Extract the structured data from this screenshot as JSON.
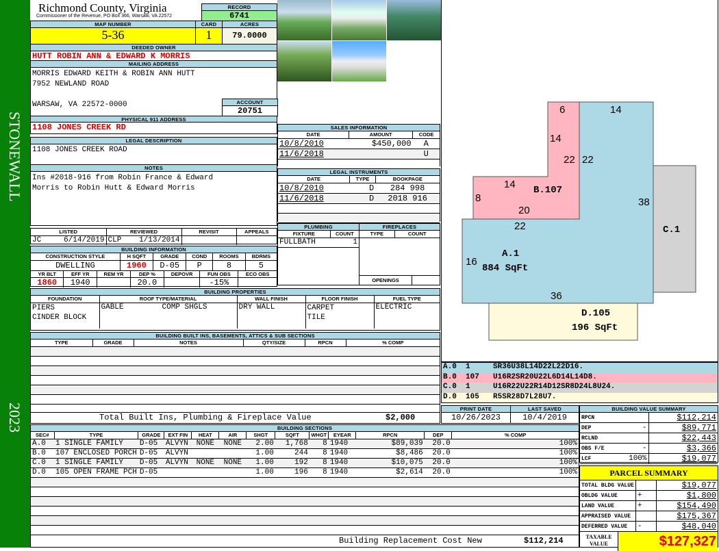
{
  "sidebar": {
    "district": "STONEWALL",
    "year": "2023"
  },
  "header": {
    "county": "Richmond County, Virginia",
    "office": "Commissioner of the Revenue, PO Box 366, Warsaw, VA 22572",
    "record_label": "RECORD",
    "record": "6741"
  },
  "parcel": {
    "map_label": "MAP NUMBER",
    "map": "5-36",
    "card_label": "CARD",
    "card": "1",
    "acres_label": "ACRES",
    "acres": "79.0000"
  },
  "owner": {
    "label": "DEEDED OWNER",
    "value": "HUTT ROBIN ANN & EDWARD K MORRIS"
  },
  "mailing": {
    "label": "MAILING ADDRESS",
    "line1": "MORRIS EDWARD KEITH & ROBIN ANN HUTT",
    "line2": "7952 NEWLAND ROAD",
    "line3": "WARSAW, VA 22572-0000",
    "account_label": "ACCOUNT",
    "account": "20751"
  },
  "physical": {
    "label": "PHYSICAL 911 ADDRESS",
    "value": "1108 JONES CREEK RD"
  },
  "legal": {
    "label": "LEGAL DESCRIPTION",
    "value": "1108 JONES CREEK ROAD"
  },
  "notes": {
    "label": "NOTES",
    "line1": "Ins #2018-916 from Robin France & Edward",
    "line2": "Morris to Robin Hutt & Edward Morris"
  },
  "review": {
    "listed_label": "LISTED",
    "listed_by": "JC",
    "listed": "6/14/2019",
    "reviewed_label": "REVIEWED",
    "reviewed_by": "CLP",
    "reviewed": "1/13/2014",
    "revisit_label": "REVISIT",
    "appeals_label": "APPEALS"
  },
  "building_info": {
    "label": "BUILDING INFORMATION",
    "h1": [
      "CONSTRUCTION STYLE",
      "H SQFT",
      "GRADE",
      "COND",
      "ROOMS",
      "BDRMS"
    ],
    "v1": [
      "DWELLING",
      "1960",
      "D-05",
      "P",
      "8",
      "5"
    ],
    "h2": [
      "YR BLT",
      "EFF YR",
      "REM YR",
      "DEP %",
      "DEPOVR",
      "FUN OBS",
      "ECO OBS"
    ],
    "v2": [
      "1860",
      "1940",
      "",
      "20.0",
      "",
      "-15%",
      ""
    ]
  },
  "sales": {
    "label": "SALES INFORMATION",
    "cols": [
      "DATE",
      "AMOUNT",
      "CODE"
    ],
    "rows": [
      [
        "10/8/2010",
        "$450,000",
        "A"
      ],
      [
        "11/6/2018",
        "",
        "U"
      ]
    ]
  },
  "instruments": {
    "label": "LEGAL INSTRUMENTS",
    "cols": [
      "DATE",
      "TYPE",
      "BOOKPAGE"
    ],
    "rows": [
      [
        "10/8/2010",
        "D",
        "284 998"
      ],
      [
        "11/6/2018",
        "D",
        "2018 916"
      ]
    ]
  },
  "plumbing": {
    "label": "PLUMBING",
    "cols": [
      "FIXTURE",
      "COUNT"
    ],
    "rows": [
      [
        "FULLBATH",
        "1"
      ]
    ]
  },
  "fireplaces": {
    "label": "FIREPLACES",
    "cols": [
      "TYPE",
      "COUNT"
    ],
    "openings": "OPENINGS"
  },
  "properties": {
    "label": "BUILDING PROPERTIES",
    "cols": [
      "FOUNDATION",
      "ROOF TYPE/MATERIAL",
      "WALL FINISH",
      "FLOOR FINISH",
      "FUEL TYPE"
    ],
    "foundation": [
      "PIERS",
      "CINDER BLOCK"
    ],
    "roof_type": "GABLE",
    "roof_material": "COMP SHGLS",
    "wall": "DRY WALL",
    "floor": [
      "CARPET",
      "TILE"
    ],
    "fuel": "ELECTRIC"
  },
  "builtins": {
    "label": "BUILDING BUILT INS, BASEMENTS, ATTICS & SUB SECTIONS",
    "cols": [
      "TYPE",
      "GRADE",
      "NOTES",
      "QTY/SIZE",
      "RPCN",
      "% COMP"
    ],
    "total_label": "Total Built Ins, Plumbing & Fireplace Value",
    "total": "$2,000"
  },
  "dates": {
    "print_label": "PRINT DATE",
    "print": "10/26/2023",
    "saved_label": "LAST SAVED",
    "saved": "10/4/2019"
  },
  "sections": {
    "label": "BUILDING SECTIONS",
    "cols": [
      "SEC#",
      "TYPE",
      "GRADE",
      "EXT FIN",
      "HEAT",
      "AIR",
      "SHGT",
      "SQFT",
      "WHGT",
      "EYEAR",
      "RPCN",
      "DEP",
      "% COMP"
    ],
    "rows": [
      [
        "A.0",
        "1 SINGLE FAMILY",
        "D-05",
        "ALVYN",
        "NONE",
        "NONE",
        "2.00",
        "1,768",
        "8",
        "1940",
        "$89,039",
        "20.0",
        "100%"
      ],
      [
        "B.0",
        "107 ENCLOSED PORCH",
        "D-05",
        "ALVYN",
        "",
        "",
        "1.00",
        "244",
        "8",
        "1940",
        "$8,486",
        "20.0",
        "100%"
      ],
      [
        "C.0",
        "1 SINGLE FAMILY",
        "D-05",
        "ALVYN",
        "NONE",
        "NONE",
        "1.00",
        "192",
        "8",
        "1940",
        "$10,075",
        "20.0",
        "100%"
      ],
      [
        "D.0",
        "105 OPEN FRAME PCH",
        "D-05",
        "",
        "",
        "",
        "1.00",
        "196",
        "8",
        "1940",
        "$2,614",
        "20.0",
        "100%"
      ]
    ],
    "total_label": "Building Replacement Cost New",
    "total": "$112,214"
  },
  "sketch": {
    "labels": {
      "a": "A.1",
      "a_area": "884 SqFt",
      "b": "B.107",
      "c": "C.1",
      "d": "D.105",
      "d_area": "196 SqFt"
    },
    "dims": [
      "6",
      "14",
      "14",
      "22",
      "22",
      "14",
      "8",
      "20",
      "22",
      "38",
      "16",
      "36"
    ],
    "legend": [
      {
        "sec": "A.0",
        "code": "1",
        "path": "SR36U38L14D22L22D16.",
        "color": "#add8e6"
      },
      {
        "sec": "B.0",
        "code": "107",
        "path": "U16R2SR20U22L6D14L14D8.",
        "color": "#ffb6c1"
      },
      {
        "sec": "C.0",
        "code": "1",
        "path": "U16R22U22R14D12SR8D24L8U24.",
        "color": "#d3d3d3"
      },
      {
        "sec": "D.0",
        "code": "105",
        "path": "R5SR28D7L28U7.",
        "color": "#fffadc"
      }
    ]
  },
  "value_summary": {
    "label": "BUILDING VALUE SUMMARY",
    "rows": [
      {
        "label": "RPCN",
        "sign": "",
        "value": "$112,214"
      },
      {
        "label": "DEP",
        "sign": "-",
        "value": "$89,771"
      },
      {
        "label": "RCLND",
        "sign": "",
        "value": "$22,443"
      },
      {
        "label": "OBS F/E",
        "sign": "-",
        "value": "$3,366"
      },
      {
        "label": "LCF",
        "sign": "100%",
        "value": "$19,077"
      }
    ]
  },
  "parcel_summary": {
    "title": "PARCEL SUMMARY",
    "rows": [
      {
        "label": "TOTAL BLDG VALUE",
        "sign": "",
        "value": "$19,077"
      },
      {
        "label": "OBLDG VALUE",
        "sign": "+",
        "value": "$1,800"
      },
      {
        "label": "LAND VALUE",
        "sign": "+",
        "value": "$154,490"
      },
      {
        "label": "APPRAISED VALUE",
        "sign": "",
        "value": "$175,367"
      },
      {
        "label": "DEFERRED VALUE",
        "sign": "-",
        "value": "$48,040"
      }
    ],
    "taxable_label": "TAXABLE VALUE",
    "taxable": "$127,327"
  }
}
